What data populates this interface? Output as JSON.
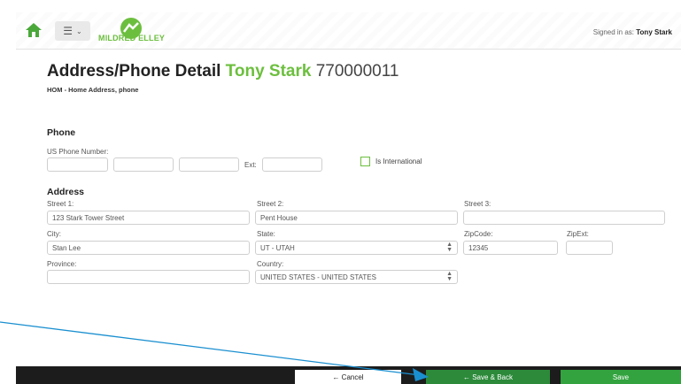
{
  "header": {
    "logo_text": "MILDRED ELLEY",
    "signed_in_prefix": "Signed in as:",
    "signed_in_user": "Tony Stark",
    "menu_icon": "hamburger-icon",
    "home_icon": "home-icon"
  },
  "page": {
    "title_prefix": "Address/Phone Detail",
    "title_name": "Tony Stark",
    "title_id": "770000011",
    "subtitle": "HOM - Home Address, phone"
  },
  "phone": {
    "section_title": "Phone",
    "us_label": "US Phone Number:",
    "area": "",
    "prefix": "",
    "line": "",
    "ext_label": "Ext:",
    "ext": "",
    "intl_label": "Is International",
    "intl_checked": false
  },
  "address": {
    "section_title": "Address",
    "street1_label": "Street 1:",
    "street1": "123 Stark Tower Street",
    "street2_label": "Street 2:",
    "street2": "Pent House",
    "street3_label": "Street 3:",
    "street3": "",
    "city_label": "City:",
    "city": "Stan Lee",
    "state_label": "State:",
    "state": "UT - UTAH",
    "zip_label": "ZipCode:",
    "zip": "12345",
    "zipext_label": "ZipExt:",
    "zipext": "",
    "province_label": "Province:",
    "province": "",
    "country_label": "Country:",
    "country": "UNITED STATES - UNITED STATES"
  },
  "footer": {
    "cancel": "← Cancel",
    "save_back": "← Save & Back",
    "save": "Save"
  },
  "colors": {
    "accent": "#6cbf3e",
    "save_back_bg": "#2c8a3a",
    "save_bg": "#33a33f",
    "annotation": "#1a8fd0"
  }
}
